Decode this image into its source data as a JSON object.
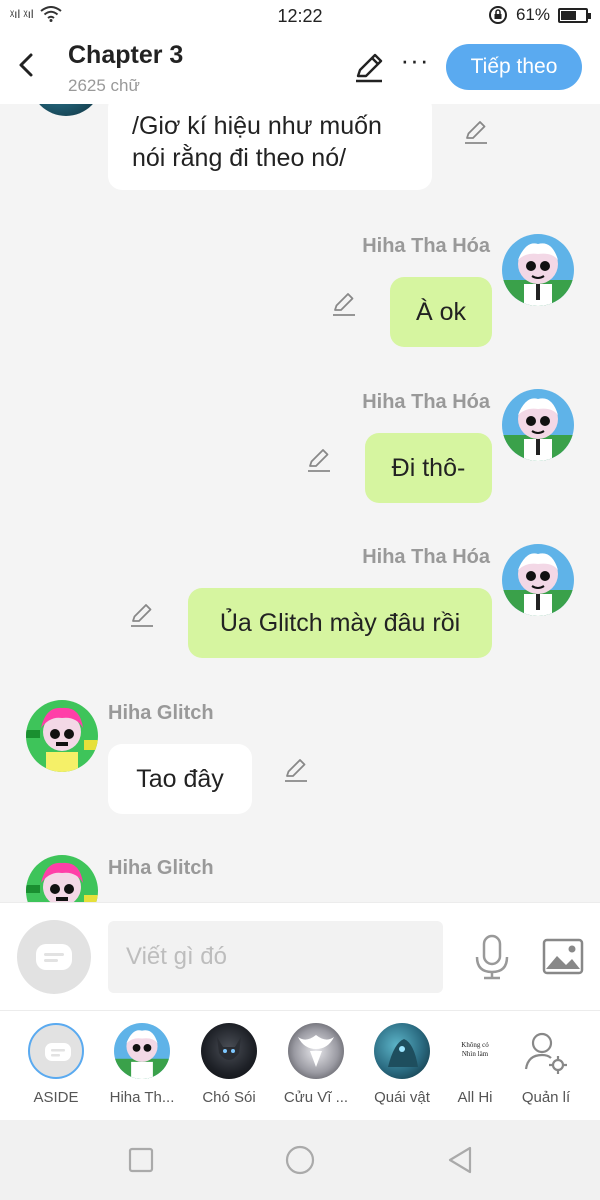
{
  "status": {
    "signal_text": "ᵡıl ᵡıl",
    "time": "12:22",
    "battery": "61%",
    "battery_level": 0.61
  },
  "header": {
    "title": "Chapter 3",
    "word_count": "2625 chữ",
    "next_label": "Tiếp theo",
    "more_label": "···"
  },
  "messages": [
    {
      "side": "left",
      "sender": "",
      "text_lines": [
        "/Giơ kí hiệu như muốn",
        "nói rằng đi theo nó/"
      ]
    },
    {
      "side": "right",
      "sender": "Hiha Tha Hóa",
      "text": "À ok"
    },
    {
      "side": "right",
      "sender": "Hiha Tha Hóa",
      "text": "Đi thô-"
    },
    {
      "side": "right",
      "sender": "Hiha Tha Hóa",
      "text": "Ủa Glitch mày đâu rồi"
    },
    {
      "side": "left",
      "sender": "Hiha Glitch",
      "text": "Tao đây"
    },
    {
      "side": "left",
      "sender": "Hiha Glitch",
      "text": ""
    }
  ],
  "composer": {
    "placeholder": "Viết gì đó"
  },
  "characters": [
    {
      "name": "ASIDE",
      "icon": "aside-icon"
    },
    {
      "name": "Hiha Th...",
      "icon": "avatar-tha-hoa"
    },
    {
      "name": "Chó Sói",
      "icon": "avatar-wolf"
    },
    {
      "name": "Cửu Vĩ ...",
      "icon": "avatar-fox"
    },
    {
      "name": "Quái vật",
      "icon": "avatar-monster"
    },
    {
      "name": "All Hi",
      "icon": "avatar-all-hi",
      "logo_text": "Không có Nhìn làm"
    },
    {
      "name": "Quản lí",
      "icon": "manage-icon"
    }
  ],
  "colors": {
    "accent": "#5aaaf0",
    "bubble_green": "#d6f5a0",
    "bubble_white": "#ffffff"
  }
}
